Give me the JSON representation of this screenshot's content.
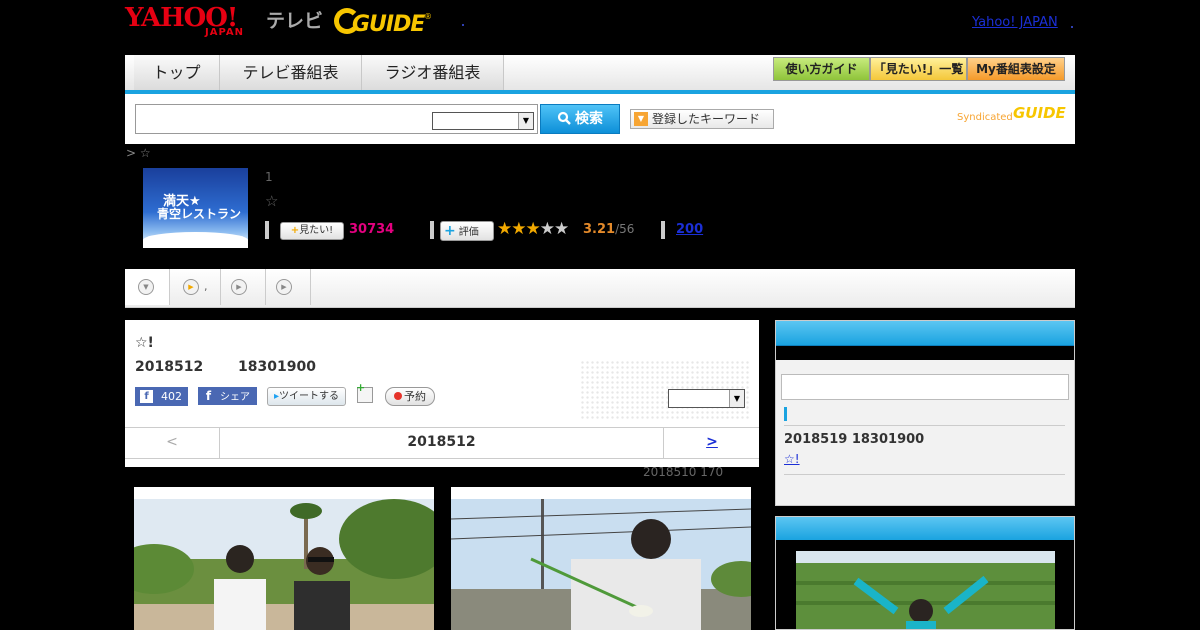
{
  "header": {
    "logo_yahoo": "YAHOO!",
    "logo_japan": "JAPAN",
    "logo_tv": "テレビ",
    "logo_guide": "GUIDE",
    "logo_registered": "®",
    "yahoo_japan_link": "Yahoo! JAPAN"
  },
  "nav": {
    "tabs": [
      "トップ",
      "テレビ番組表",
      "ラジオ番組表"
    ],
    "buttons": [
      "使い方ガイド",
      "「見たい!」一覧",
      "My番組表設定"
    ]
  },
  "search": {
    "input_value": "",
    "select_value": "",
    "button_label": "検索",
    "keyword_button": "登録したキーワード",
    "syndicated": "Syndicated",
    "syndicated_logo": "GUIDE"
  },
  "program": {
    "breadcrumb": "> ☆",
    "thumb_line1": "満天★",
    "thumb_line2": "青空レストラン",
    "episode_number": "1",
    "title_star": "☆",
    "mitai_button": "見たい!",
    "mitai_count": "30734",
    "hyoka_button": "評価",
    "stars_filled": "★★★",
    "stars_empty": "★★",
    "rating": "3.21",
    "rating_count": "/56",
    "review_count": "200"
  },
  "episode": {
    "title": "☆!",
    "date": "2018512",
    "time": "18301900",
    "fb_like": "f",
    "fb_like_count": "402",
    "fb_share": "シェア",
    "fb_share_icon": "f",
    "tweet": "ツイートする",
    "reserve": "予約",
    "select_value": "",
    "pager_prev": "<",
    "pager_current": "2018512",
    "pager_next": ">",
    "update_info": "2018510  170"
  },
  "tabs_row": {
    "items": [
      {
        "icon": "chevron-down-icon",
        "glyph": "▼",
        "label": ""
      },
      {
        "icon": "play-icon",
        "glyph": "▶",
        "label": ","
      },
      {
        "icon": "play-icon",
        "glyph": "▶",
        "label": ""
      },
      {
        "icon": "play-icon",
        "glyph": "▶",
        "label": ""
      }
    ]
  },
  "sidebar": {
    "next_date": "2018519  18301900",
    "next_link": "☆!"
  },
  "colors": {
    "accent": "#1aa3e0",
    "yahoo_red": "#e60012",
    "guide_yellow": "#f7c600",
    "mitai_pink": "#e4007f",
    "rating_orange": "#e48a2a",
    "link_blue": "#1b2fd6"
  }
}
